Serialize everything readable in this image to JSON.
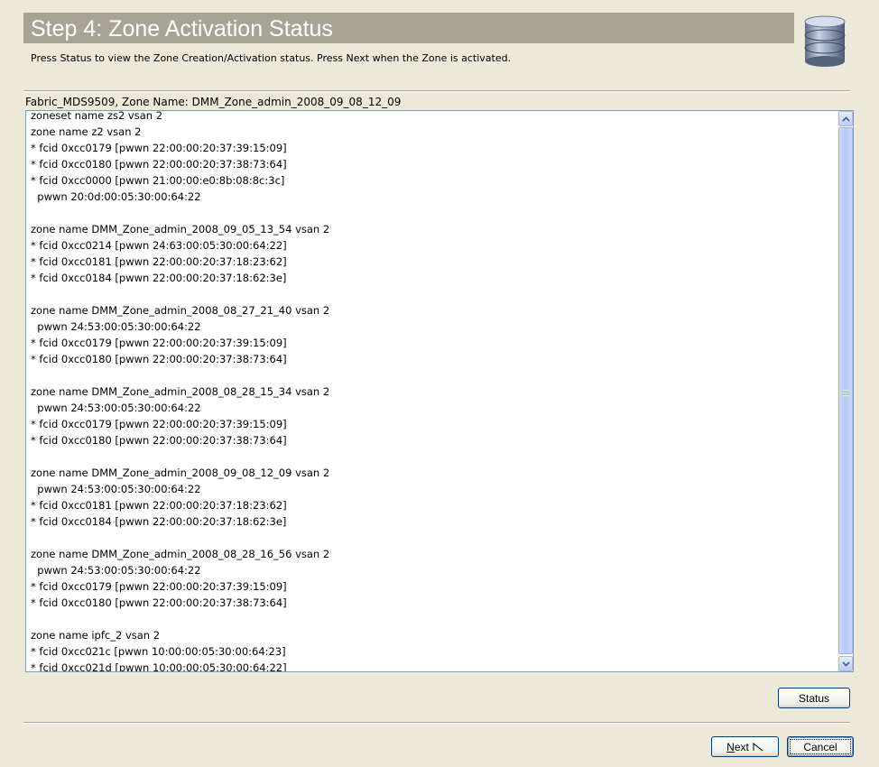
{
  "header": {
    "title": "Step 4: Zone Activation Status",
    "description": "Press Status to view the Zone Creation/Activation status. Press Next when the Zone is activated.",
    "icon": "database-icon"
  },
  "fabric_label": "Fabric_MDS9509, Zone Name: DMM_Zone_admin_2008_09_08_12_09",
  "zone_text": {
    "lines": [
      "zoneset name zs2 vsan 2",
      "zone name z2 vsan 2",
      "* fcid 0xcc0179 [pwwn 22:00:00:20:37:39:15:09]",
      "* fcid 0xcc0180 [pwwn 22:00:00:20:37:38:73:64]",
      "* fcid 0xcc0000 [pwwn 21:00:00:e0:8b:08:8c:3c]",
      "  pwwn 20:0d:00:05:30:00:64:22",
      "",
      "zone name DMM_Zone_admin_2008_09_05_13_54 vsan 2",
      "* fcid 0xcc0214 [pwwn 24:63:00:05:30:00:64:22]",
      "* fcid 0xcc0181 [pwwn 22:00:00:20:37:18:23:62]",
      "* fcid 0xcc0184 [pwwn 22:00:00:20:37:18:62:3e]",
      "",
      "zone name DMM_Zone_admin_2008_08_27_21_40 vsan 2",
      "  pwwn 24:53:00:05:30:00:64:22",
      "* fcid 0xcc0179 [pwwn 22:00:00:20:37:39:15:09]",
      "* fcid 0xcc0180 [pwwn 22:00:00:20:37:38:73:64]",
      "",
      "zone name DMM_Zone_admin_2008_08_28_15_34 vsan 2",
      "  pwwn 24:53:00:05:30:00:64:22",
      "* fcid 0xcc0179 [pwwn 22:00:00:20:37:39:15:09]",
      "* fcid 0xcc0180 [pwwn 22:00:00:20:37:38:73:64]",
      "",
      "zone name DMM_Zone_admin_2008_09_08_12_09 vsan 2",
      "  pwwn 24:53:00:05:30:00:64:22",
      "* fcid 0xcc0181 [pwwn 22:00:00:20:37:18:23:62]",
      "* fcid 0xcc0184 [pwwn 22:00:00:20:37:18:62:3e]",
      "",
      "zone name DMM_Zone_admin_2008_08_28_16_56 vsan 2",
      "  pwwn 24:53:00:05:30:00:64:22",
      "* fcid 0xcc0179 [pwwn 22:00:00:20:37:39:15:09]",
      "* fcid 0xcc0180 [pwwn 22:00:00:20:37:38:73:64]",
      "",
      "zone name ipfc_2 vsan 2",
      "* fcid 0xcc021c [pwwn 10:00:00:05:30:00:64:23]",
      "* fcid 0xcc021d [pwwn 10:00:00:05:30:00:64:22]"
    ]
  },
  "buttons": {
    "status": "Status",
    "next_mnemonic": "N",
    "next_rest": "ext",
    "cancel": "Cancel"
  },
  "colors": {
    "header_band": "#a8a495",
    "dialog_bg": "#ece9d8",
    "textarea_border": "#7f9db9",
    "scrollbar_thumb": "#b8cbf6"
  }
}
